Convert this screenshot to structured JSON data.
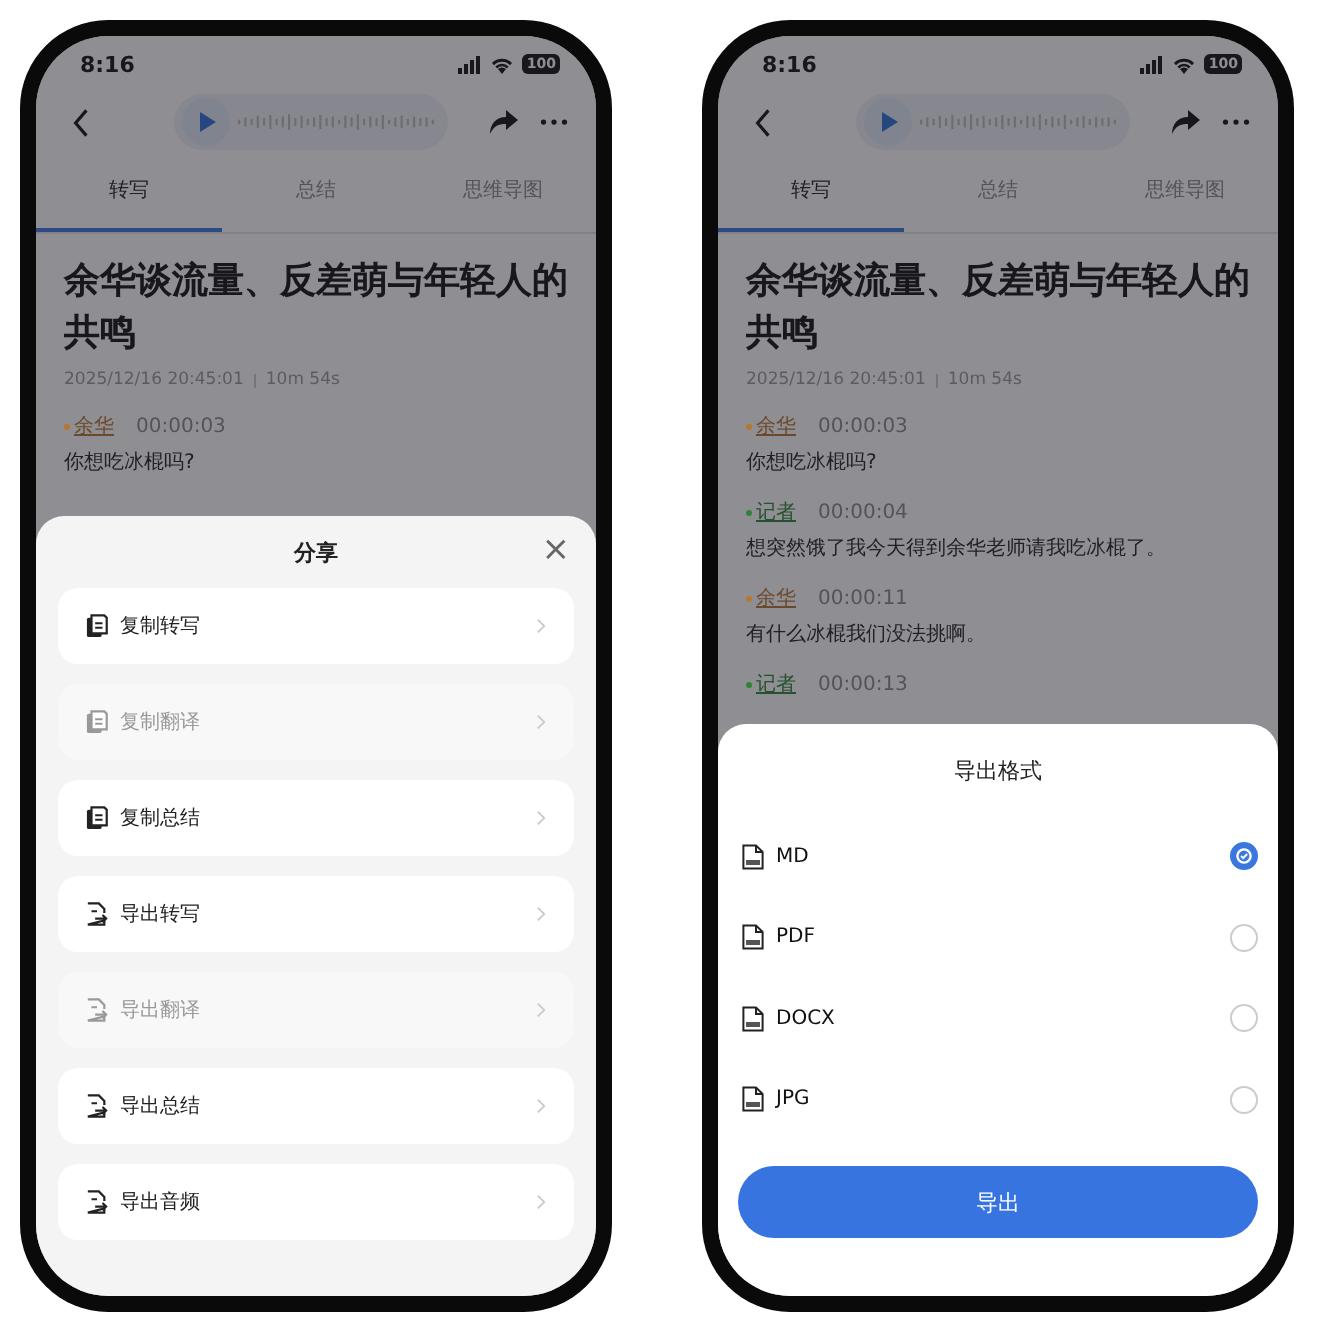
{
  "phones": [
    {
      "status": {
        "time": "8:16",
        "battery": "100"
      },
      "tabs": [
        {
          "label": "转写",
          "selected": true
        },
        {
          "label": "总结",
          "selected": false
        },
        {
          "label": "思维导图",
          "selected": false
        }
      ],
      "title": "余华谈流量、反差萌与年轻人的共鸣",
      "date": "2025/12/16 20:45:01",
      "duration": "10m 54s",
      "entries": [
        {
          "speaker": "余华",
          "color": "#b8762f",
          "time": "00:00:03",
          "text": "你想吃冰棍吗?"
        }
      ],
      "sheet": {
        "kind": "share",
        "title": "分享",
        "close": "×",
        "items": [
          {
            "label": "复制转写",
            "kind": "copy",
            "disabled": false
          },
          {
            "label": "复制翻译",
            "kind": "copy",
            "disabled": true
          },
          {
            "label": "复制总结",
            "kind": "copy",
            "disabled": false
          },
          {
            "label": "导出转写",
            "kind": "export",
            "disabled": false
          },
          {
            "label": "导出翻译",
            "kind": "export",
            "disabled": true
          },
          {
            "label": "导出总结",
            "kind": "export",
            "disabled": false
          },
          {
            "label": "导出音频",
            "kind": "export",
            "disabled": false
          }
        ]
      }
    },
    {
      "status": {
        "time": "8:16",
        "battery": "100"
      },
      "tabs": [
        {
          "label": "转写",
          "selected": true
        },
        {
          "label": "总结",
          "selected": false
        },
        {
          "label": "思维导图",
          "selected": false
        }
      ],
      "title": "余华谈流量、反差萌与年轻人的共鸣",
      "date": "2025/12/16 20:45:01",
      "duration": "10m 54s",
      "entries": [
        {
          "speaker": "余华",
          "color": "#b8762f",
          "time": "00:00:03",
          "text": "你想吃冰棍吗?"
        },
        {
          "speaker": "记者",
          "color": "#2d8436",
          "time": "00:00:04",
          "text": "想突然饿了我今天得到余华老师请我吃冰棍了。"
        },
        {
          "speaker": "余华",
          "color": "#b8762f",
          "time": "00:00:11",
          "text": "有什么冰棍我们没法挑啊。"
        },
        {
          "speaker": "记者",
          "color": "#2d8436",
          "time": "00:00:13"
        }
      ],
      "sheet": {
        "kind": "format",
        "title": "导出格式",
        "options": [
          {
            "label": "MD",
            "selected": true
          },
          {
            "label": "PDF",
            "selected": false
          },
          {
            "label": "DOCX",
            "selected": false
          },
          {
            "label": "JPG",
            "selected": false
          }
        ],
        "button": "导出"
      }
    }
  ]
}
